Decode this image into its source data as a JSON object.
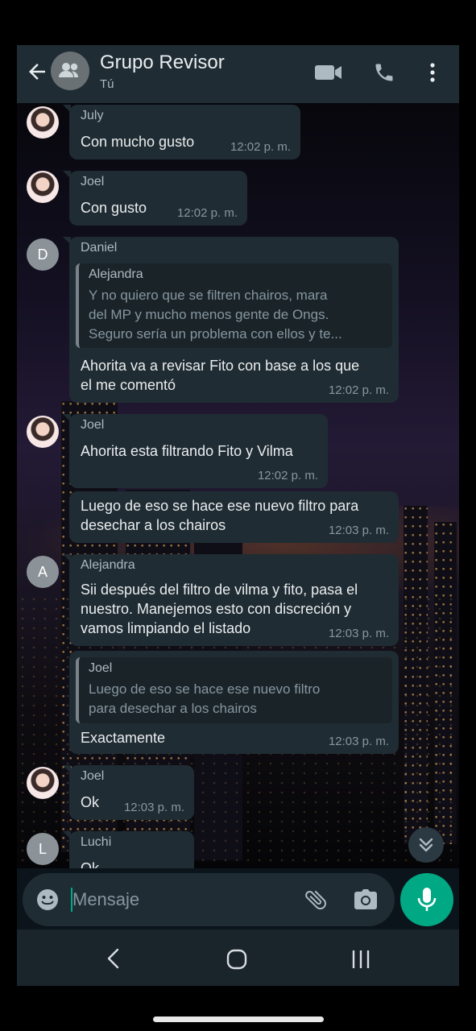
{
  "header": {
    "title": "Grupo Revisor",
    "subtitle": "Tú",
    "icons": [
      "back-arrow-icon",
      "group-icon",
      "video-call-icon",
      "phone-call-icon",
      "more-options-icon"
    ]
  },
  "messages": [
    {
      "sender": "July",
      "text": "Con mucho gusto",
      "time": "12:02 p. m."
    },
    {
      "sender": "Joel",
      "text": "Con gusto",
      "time": "12:02 p. m."
    },
    {
      "sender": "Daniel",
      "avatar_letter": "D",
      "quote": {
        "sender": "Alejandra",
        "lines": [
          "Y no quiero que se filtren chairos, mara",
          "del MP y mucho menos gente de Ongs.",
          "Seguro sería un problema con ellos y te..."
        ]
      },
      "lines": [
        "Ahorita va a revisar Fito con base a los que",
        "el me comentó"
      ],
      "time": "12:02 p. m."
    },
    {
      "sender": "Joel",
      "text": "Ahorita esta filtrando Fito y Vilma",
      "time": "12:02 p. m."
    },
    {
      "lines": [
        "Luego de eso se hace ese nuevo filtro para",
        "desechar a los chairos"
      ],
      "time": "12:03 p. m."
    },
    {
      "sender": "Alejandra",
      "avatar_letter": "A",
      "lines": [
        "Sii después del filtro de vilma y fito, pasa el",
        "nuestro. Manejemos esto con discreción y",
        "vamos limpiando el listado"
      ],
      "time": "12:03 p. m."
    },
    {
      "quote": {
        "sender": "Joel",
        "lines": [
          "Luego de eso se hace ese nuevo filtro",
          "para desechar a los chairos"
        ]
      },
      "text": "Exactamente",
      "time": "12:03 p. m."
    },
    {
      "sender": "Joel",
      "text": "Ok",
      "time": "12:03 p. m."
    },
    {
      "sender": "Luchi",
      "avatar_letter": "L",
      "text": "Ok"
    }
  ],
  "input": {
    "placeholder": "Mensaje"
  },
  "colors": {
    "accent": "#00a884",
    "bubble": "#202c33",
    "header": "#1f2c34"
  }
}
